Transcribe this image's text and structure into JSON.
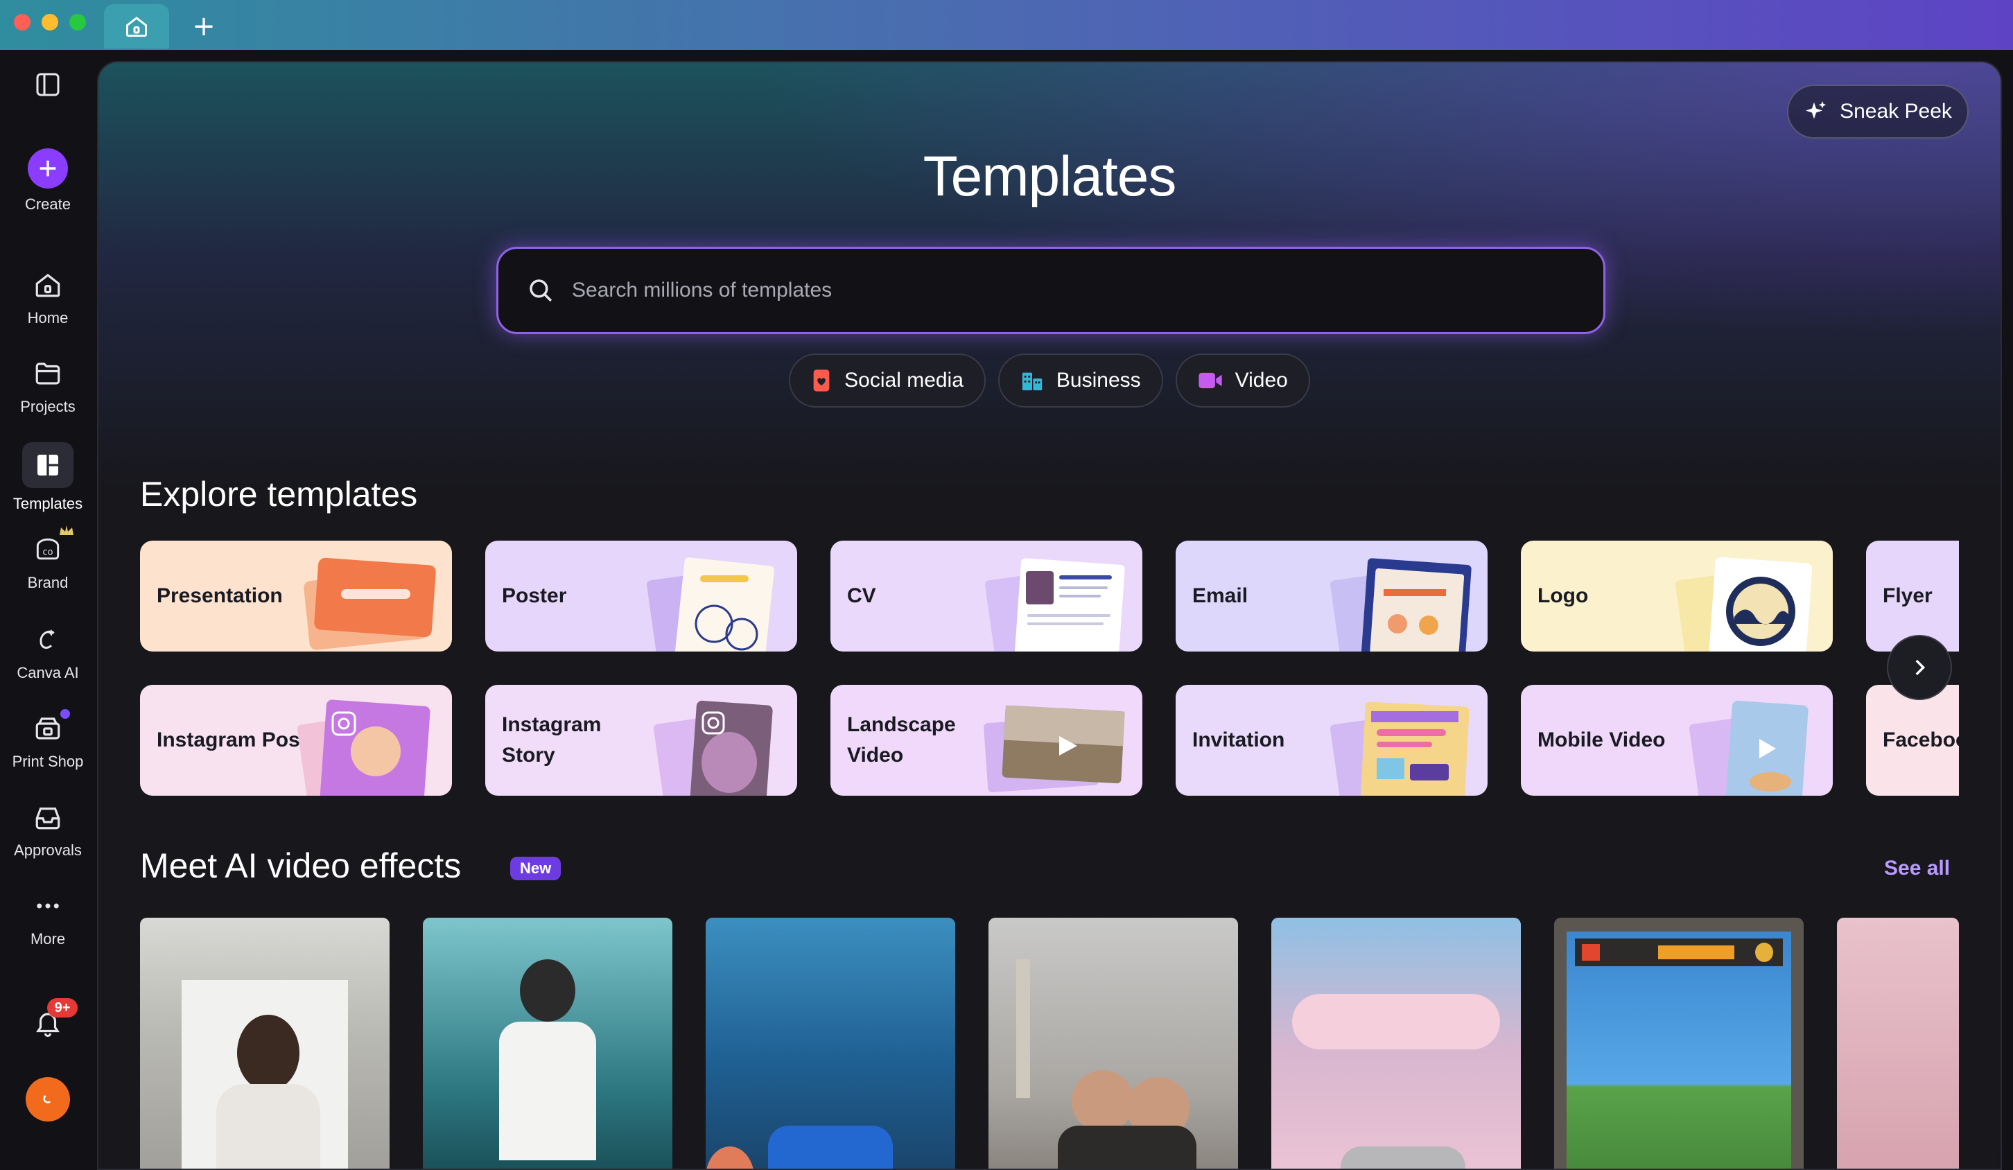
{
  "window": {
    "traffic_lights": {
      "close": "#ff5f57",
      "minimize": "#febc2e",
      "maximize": "#28c840"
    },
    "new_tab_glyph": "+"
  },
  "sidebar": {
    "items": [
      {
        "id": "create",
        "label": "Create",
        "icon": "plus-icon"
      },
      {
        "id": "home",
        "label": "Home",
        "icon": "home-icon"
      },
      {
        "id": "projects",
        "label": "Projects",
        "icon": "folder-icon"
      },
      {
        "id": "templates",
        "label": "Templates",
        "icon": "templates-icon"
      },
      {
        "id": "brand",
        "label": "Brand",
        "icon": "brand-icon"
      },
      {
        "id": "canva-ai",
        "label": "Canva AI",
        "icon": "canva-ai-icon"
      },
      {
        "id": "print-shop",
        "label": "Print Shop",
        "icon": "print-shop-icon"
      },
      {
        "id": "approvals",
        "label": "Approvals",
        "icon": "approvals-icon"
      },
      {
        "id": "more",
        "label": "More",
        "icon": "more-icon"
      }
    ],
    "notifications_badge": "9+"
  },
  "header": {
    "sneak_peek_label": "Sneak Peek",
    "title": "Templates",
    "search_placeholder": "Search millions of templates",
    "chips": [
      {
        "label": "Social media",
        "icon": "social-media-icon",
        "color": "#ff5a4e"
      },
      {
        "label": "Business",
        "icon": "business-icon",
        "color": "#36b6d6"
      },
      {
        "label": "Video",
        "icon": "video-icon",
        "color": "#c65bef"
      }
    ]
  },
  "explore": {
    "title": "Explore templates",
    "row1": [
      {
        "label": "Presentation",
        "bg": "#fde2cd"
      },
      {
        "label": "Poster",
        "bg": "#e6d6fb"
      },
      {
        "label": "CV",
        "bg": "#ead9fb"
      },
      {
        "label": "Email",
        "bg": "#ddd7fb"
      },
      {
        "label": "Logo",
        "bg": "#fbf1cd"
      },
      {
        "label": "Flyer",
        "bg": "#e6d6fb"
      }
    ],
    "row2": [
      {
        "label": "Instagram Post",
        "bg": "#f8e2ef"
      },
      {
        "label": "Instagram Story",
        "bg": "#f1dcf9"
      },
      {
        "label": "Landscape Video",
        "bg": "#f0d9fb"
      },
      {
        "label": "Invitation",
        "bg": "#e9dafb"
      },
      {
        "label": "Mobile Video",
        "bg": "#efd8fa"
      },
      {
        "label": "Facebook Post",
        "bg": "#fbe3ea"
      }
    ]
  },
  "ai_effects": {
    "title": "Meet AI video effects",
    "badge": "New",
    "see_all": "See all"
  },
  "help_label": "?"
}
